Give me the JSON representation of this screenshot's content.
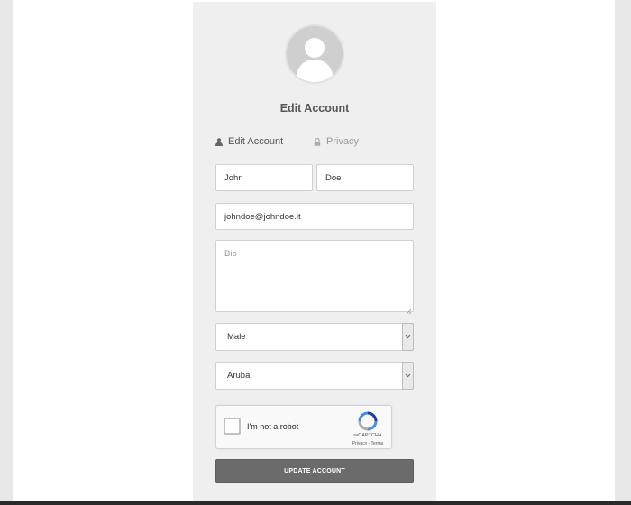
{
  "profile": {
    "title": "Edit Account",
    "avatar_icon": "user-avatar-icon"
  },
  "tabs": [
    {
      "label": "Edit Account",
      "icon": "user-icon",
      "active": true
    },
    {
      "label": "Privacy",
      "icon": "lock-icon",
      "active": false
    }
  ],
  "form": {
    "first_name": {
      "value": "John",
      "placeholder": ""
    },
    "last_name": {
      "value": "Doe",
      "placeholder": ""
    },
    "email": {
      "value": "johndoe@johndoe.it",
      "placeholder": ""
    },
    "bio": {
      "value": "",
      "placeholder": "Bio"
    },
    "gender": {
      "selected": "Male"
    },
    "country": {
      "selected": "Aruba"
    },
    "submit_label": "UPDATE ACCOUNT"
  },
  "captcha": {
    "label": "I'm not a robot",
    "brand": "reCAPTCHA",
    "links": "Privacy - Terms",
    "checked": false
  },
  "colors": {
    "panel_bg": "#efefef",
    "button_bg": "#6b6b6b",
    "avatar_bg": "#cfcfcf"
  }
}
